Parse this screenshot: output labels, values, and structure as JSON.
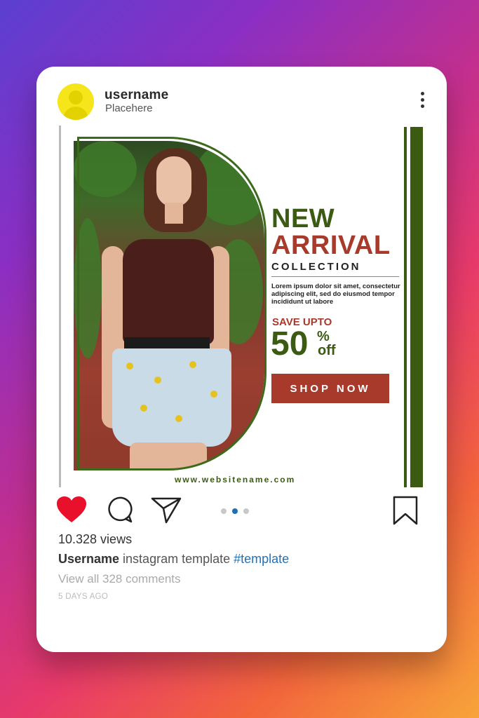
{
  "header": {
    "username": "username",
    "place": "Placehere"
  },
  "post": {
    "headline_1": "NEW",
    "headline_2": "ARRIVAL",
    "subheadline": "COLLECTION",
    "body": "Lorem ipsum dolor sit amet, consectetur adipiscing elit, sed do eiusmod tempor incididunt ut labore",
    "save_label": "SAVE UPTO",
    "discount_number": "50",
    "discount_percent": "%",
    "discount_off": "off",
    "cta": "SHOP NOW",
    "website": "www.websitename.com"
  },
  "actions": {
    "icons": [
      "heart-icon",
      "comment-icon",
      "send-icon",
      "bookmark-icon"
    ],
    "carousel_dots": 3,
    "carousel_active": 2
  },
  "stats": {
    "views": "10.328 views",
    "caption_user": "Username",
    "caption_text": " instagram template ",
    "caption_tag": "#template",
    "comments_link": "View all 328 comments",
    "time_ago": "5 DAYS AGO"
  },
  "colors": {
    "accent_green": "#3b5b13",
    "accent_red": "#a83a2c",
    "heart_red": "#e8102a",
    "hashtag_blue": "#1e73be",
    "avatar_yellow": "#f5e51a"
  }
}
